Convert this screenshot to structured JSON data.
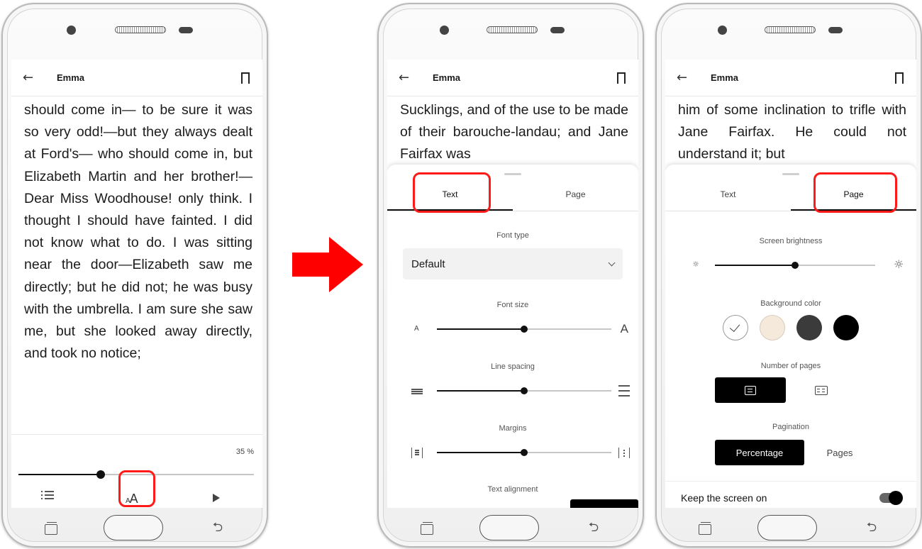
{
  "book_title": "Emma",
  "phone1": {
    "paragraph": "should come in— to be sure it was so very odd!—but they always dealt at Ford's— who should come in, but Elizabeth Martin and her brother!— Dear Miss Woodhouse! only think. I thought I should have fainted. I did not know what to do. I was sitting near the door—Elizabeth saw me directly; but he did not; he was busy with the umbrella. I am sure she saw me, but she looked away directly, and took no notice;",
    "progress_label": "35 %",
    "progress_value": 0.35,
    "toolbar": {
      "toc_icon": "list-icon",
      "font_icon": "aa-icon",
      "play_icon": "play-icon"
    }
  },
  "phone2": {
    "paragraph": "Sucklings, and of the use to be made of their barouche-landau; and Jane Fairfax was",
    "tabs": {
      "text": "Text",
      "page": "Page",
      "active": "Text"
    },
    "font_type_label": "Font type",
    "font_type_value": "Default",
    "font_size_label": "Font size",
    "font_size_small": "A",
    "font_size_large": "A",
    "font_size_value": 0.5,
    "line_spacing_label": "Line spacing",
    "line_spacing_value": 0.5,
    "margins_label": "Margins",
    "margins_value": 0.5,
    "text_alignment_label": "Text alignment"
  },
  "phone3": {
    "paragraph": "him of some inclination to trifle with Jane Fairfax. He could not understand it; but",
    "tabs": {
      "text": "Text",
      "page": "Page",
      "active": "Page"
    },
    "brightness_label": "Screen brightness",
    "brightness_value": 0.5,
    "background_label": "Background color",
    "background_colors": [
      "#ffffff",
      "#f5e9dc",
      "#3b3b3b",
      "#000000"
    ],
    "pages_label": "Number of pages",
    "pagination_label": "Pagination",
    "pagination_options": {
      "percentage": "Percentage",
      "pages": "Pages",
      "selected": "Percentage"
    },
    "keep_screen_on_label": "Keep the screen on",
    "keep_screen_on": true
  },
  "colors": {
    "highlight": "#ff1a1a",
    "arrow": "#ff0000"
  }
}
